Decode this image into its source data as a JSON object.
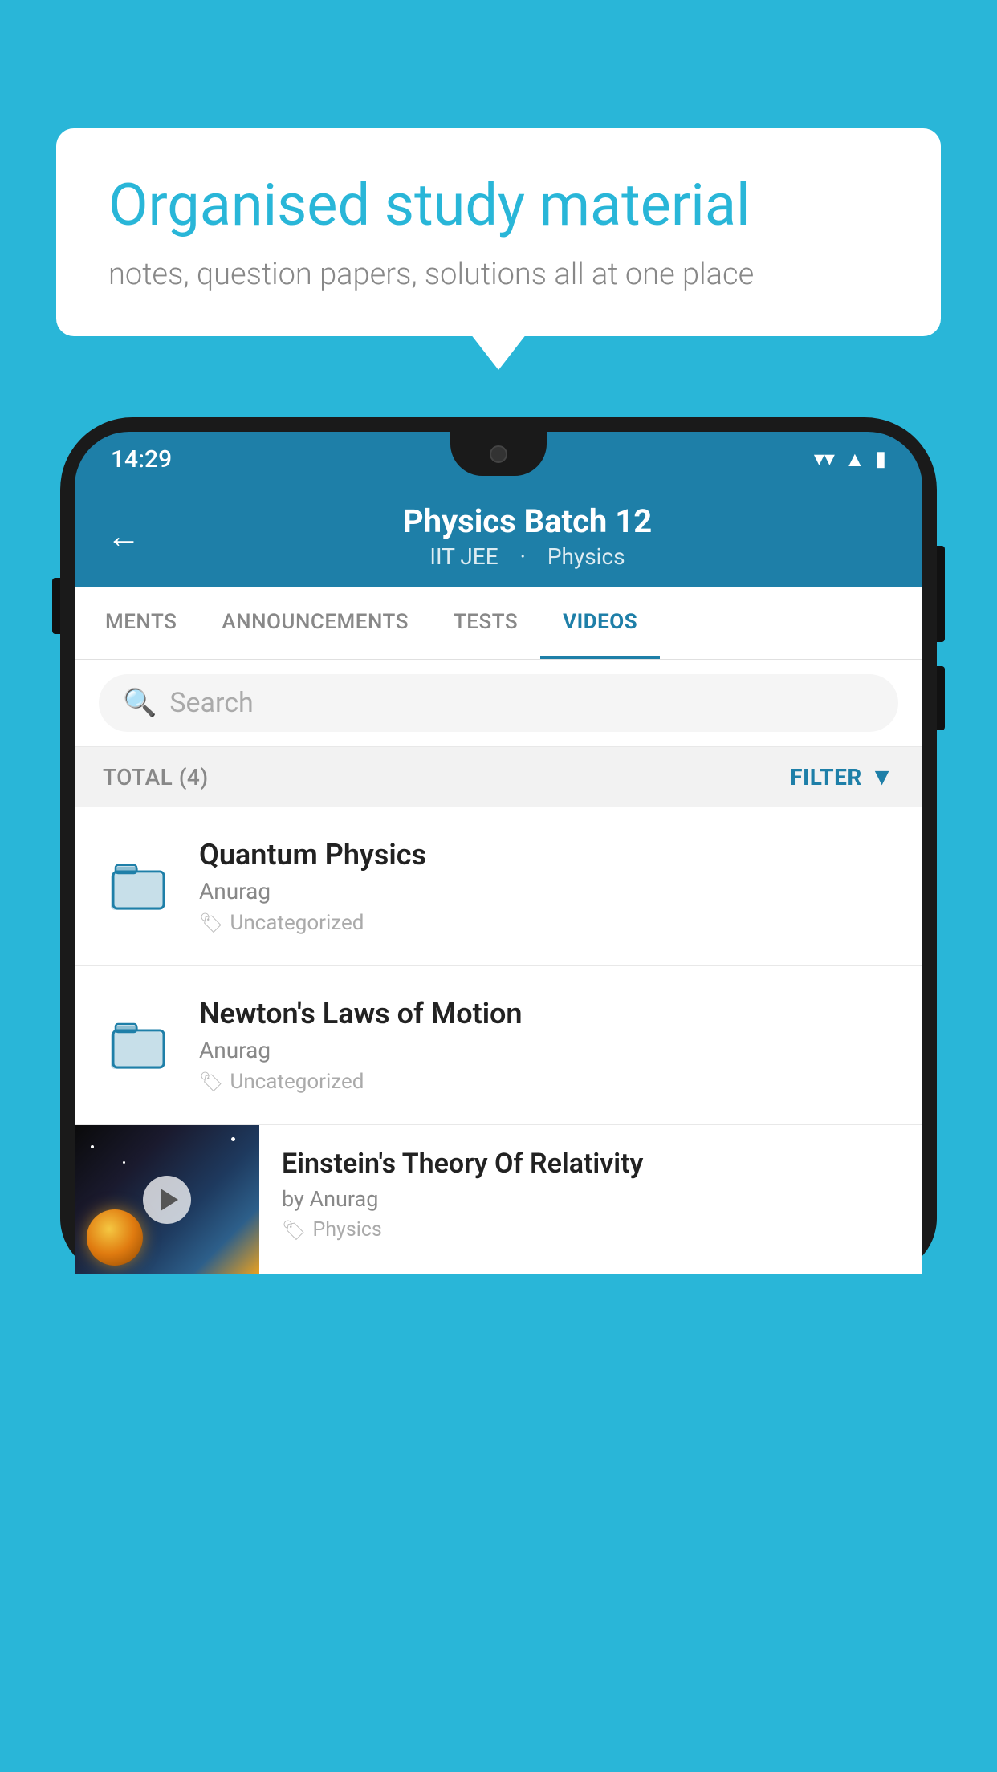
{
  "background_color": "#29b6d8",
  "speech_bubble": {
    "title": "Organised study material",
    "subtitle": "notes, question papers, solutions all at one place"
  },
  "status_bar": {
    "time": "14:29"
  },
  "app_header": {
    "title": "Physics Batch 12",
    "subtitle_part1": "IIT JEE",
    "subtitle_part2": "Physics"
  },
  "tabs": [
    {
      "label": "MENTS",
      "active": false
    },
    {
      "label": "ANNOUNCEMENTS",
      "active": false
    },
    {
      "label": "TESTS",
      "active": false
    },
    {
      "label": "VIDEOS",
      "active": true
    }
  ],
  "search": {
    "placeholder": "Search"
  },
  "filter_bar": {
    "total_label": "TOTAL (4)",
    "filter_label": "FILTER"
  },
  "videos": [
    {
      "title": "Quantum Physics",
      "author": "Anurag",
      "tag": "Uncategorized",
      "has_thumbnail": false
    },
    {
      "title": "Newton's Laws of Motion",
      "author": "Anurag",
      "tag": "Uncategorized",
      "has_thumbnail": false
    },
    {
      "title": "Einstein's Theory Of Relativity",
      "author": "by Anurag",
      "tag": "Physics",
      "has_thumbnail": true
    }
  ]
}
